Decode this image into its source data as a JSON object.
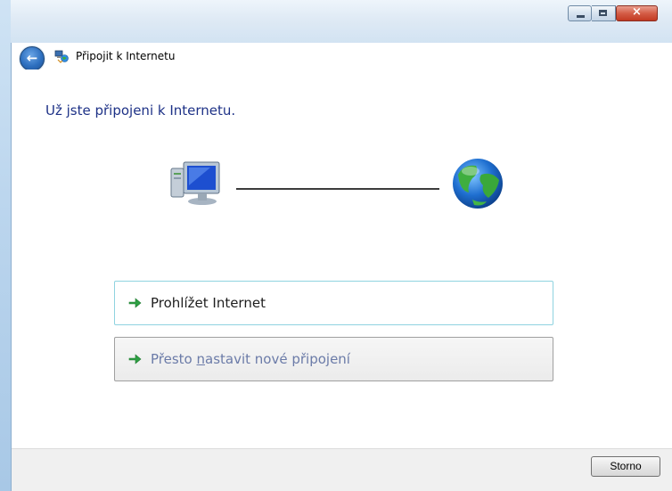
{
  "window": {
    "title": "Připojit k Internetu",
    "controls": [
      "minimize",
      "maximize",
      "close"
    ],
    "close_symbol": "×"
  },
  "navigation": {
    "back_icon": "back-arrow-icon",
    "back_symbol": "←"
  },
  "main": {
    "heading": "Už jste připojeni k Internetu.",
    "diagram": {
      "left_icon": "computer-icon",
      "right_icon": "globe-icon",
      "connector": "line"
    },
    "options": [
      {
        "label": "Prohlížet Internet",
        "icon": "green-arrow-icon"
      },
      {
        "label": "Přesto nastavit nové připojení",
        "icon": "green-arrow-icon",
        "accel_key": "n"
      }
    ]
  },
  "footer": {
    "cancel_label": "Storno"
  },
  "colors": {
    "heading": "#1e3287",
    "accent_arrow": "#2ea043",
    "option_border_primary": "#8fd3e0"
  }
}
